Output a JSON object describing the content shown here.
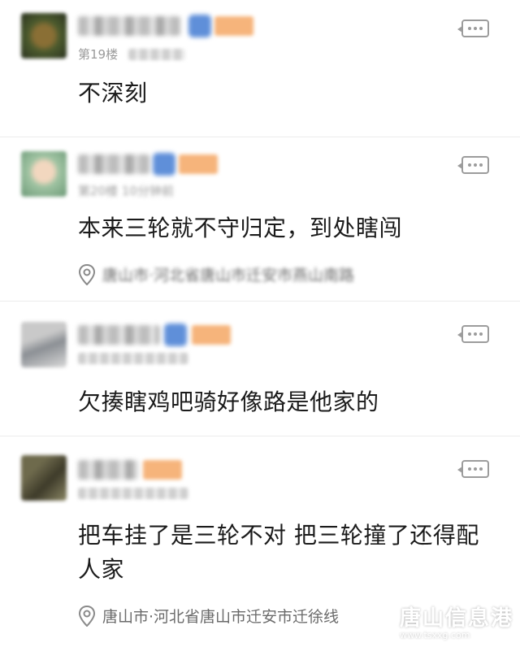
{
  "comments": [
    {
      "floor": "第19楼",
      "content": "不深刻"
    },
    {
      "floor": "第20楼 10分钟前",
      "content": "本来三轮就不守归定，到处瞎闯",
      "location": "唐山市·河北省唐山市迁安市燕山南路"
    },
    {
      "floor": "",
      "content": "欠揍瞎鸡吧骑好像路是他家的"
    },
    {
      "floor": "",
      "content": "把车挂了是三轮不对 把三轮撞了还得配人家",
      "location": "唐山市·河北省唐山市迁安市迁徐线"
    }
  ],
  "icons": {
    "more": "comment-more-icon",
    "location": "location-pin-icon"
  },
  "watermark": {
    "text": "唐山信息港",
    "url": "www.tsxxg.com"
  },
  "colors": {
    "verify_badge": "#5f8fd9",
    "level_tag": "#f6b47b",
    "meta_text": "#9a9a9a"
  }
}
